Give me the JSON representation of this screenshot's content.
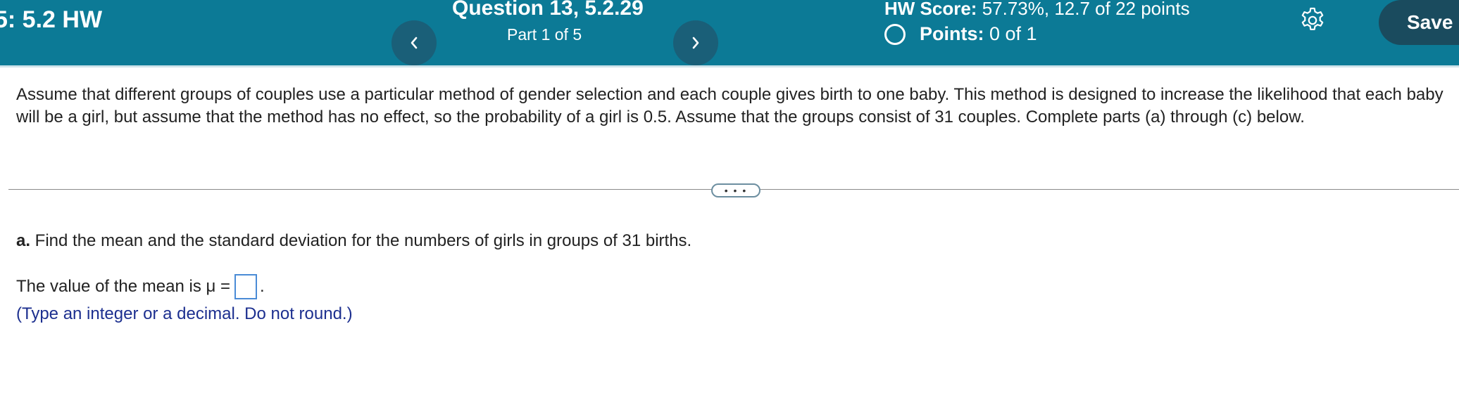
{
  "header": {
    "hw_title": "5: 5.2 HW",
    "question_title": "Question 13, 5.2.29",
    "part": "Part 1 of 5",
    "hw_score_label": "HW Score:",
    "hw_score_value": "57.73%, 12.7 of 22 points",
    "points_label": "Points:",
    "points_value": "0 of 1",
    "save_label": "Save",
    "prev_icon": "chevron-left-icon",
    "next_icon": "chevron-right-icon",
    "settings_icon": "gear-icon",
    "colors": {
      "bar": "#0c7a96",
      "nav_button": "#1a5f78",
      "save_button": "#1a4b5e"
    }
  },
  "question": {
    "text": "Assume that different groups of couples use a particular method of gender selection and each couple gives birth to one baby. This method is designed to increase the likelihood that each baby will be a girl, but assume that the method has no effect, so the probability of a girl is 0.5. Assume that the groups consist of 31 couples. Complete parts (a) through (c) below.",
    "expand_label": "• • •"
  },
  "part_a": {
    "label": "a.",
    "text": " Find the mean and the standard deviation for the numbers of girls in groups of 31 births.",
    "mean_prefix": "The value of the mean is μ =",
    "mean_suffix": ".",
    "mean_value": "",
    "hint": "(Type an integer or a decimal. Do not round.)",
    "hint_color": "#1c2f8f"
  }
}
